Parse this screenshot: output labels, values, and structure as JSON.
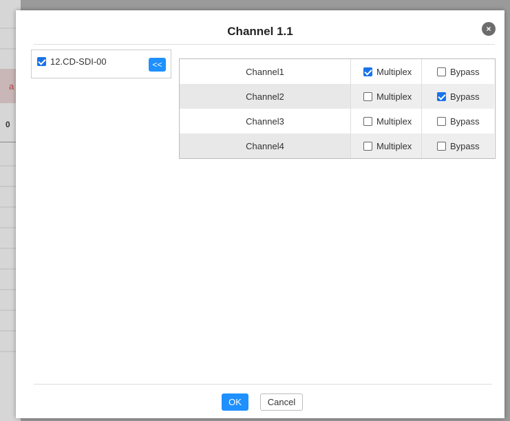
{
  "background": {
    "row_fragment_text": "a",
    "row_number_text": "0"
  },
  "dialog": {
    "title": "Channel 1.1",
    "close_icon": "×"
  },
  "source": {
    "item_label": "12.CD-SDI-00",
    "item_checked": true,
    "move_left_label": "<<"
  },
  "channels": [
    {
      "name": "Channel1",
      "multiplex_label": "Multiplex",
      "multiplex": true,
      "bypass_label": "Bypass",
      "bypass": false
    },
    {
      "name": "Channel2",
      "multiplex_label": "Multiplex",
      "multiplex": false,
      "bypass_label": "Bypass",
      "bypass": true
    },
    {
      "name": "Channel3",
      "multiplex_label": "Multiplex",
      "multiplex": false,
      "bypass_label": "Bypass",
      "bypass": false
    },
    {
      "name": "Channel4",
      "multiplex_label": "Multiplex",
      "multiplex": false,
      "bypass_label": "Bypass",
      "bypass": false
    }
  ],
  "footer": {
    "ok_label": "OK",
    "cancel_label": "Cancel"
  },
  "colors": {
    "accent": "#1e90ff",
    "checkbox_checked": "#1a73e8"
  }
}
